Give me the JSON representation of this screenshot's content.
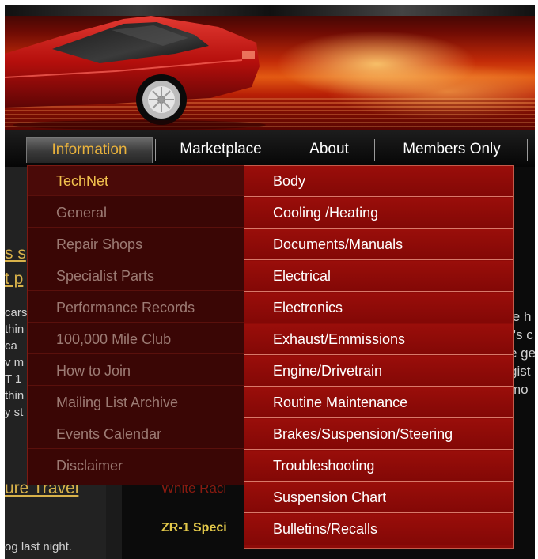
{
  "nav": {
    "items": [
      {
        "label": "Information"
      },
      {
        "label": "Marketplace"
      },
      {
        "label": "About"
      },
      {
        "label": "Members Only"
      }
    ]
  },
  "dropdown": {
    "items": [
      {
        "label": "TechNet"
      },
      {
        "label": "General"
      },
      {
        "label": "Repair Shops"
      },
      {
        "label": "Specialist Parts"
      },
      {
        "label": "Performance Records"
      },
      {
        "label": "100,000 Mile Club"
      },
      {
        "label": "How to Join"
      },
      {
        "label": "Mailing List Archive"
      },
      {
        "label": "Events Calendar"
      },
      {
        "label": "Disclaimer"
      }
    ]
  },
  "submenu": {
    "items": [
      {
        "label": "Body"
      },
      {
        "label": "Cooling /Heating"
      },
      {
        "label": "Documents/Manuals"
      },
      {
        "label": "Electrical"
      },
      {
        "label": "Electronics"
      },
      {
        "label": "Exhaust/Emmissions"
      },
      {
        "label": "Engine/Drivetrain"
      },
      {
        "label": "Routine Maintenance"
      },
      {
        "label": "Brakes/Suspension/Steering"
      },
      {
        "label": "Troubleshooting"
      },
      {
        "label": "Suspension Chart"
      },
      {
        "label": "Bulletins/Recalls"
      }
    ]
  },
  "background_fragments": {
    "left_link_1": "s s",
    "left_link_2": "t p",
    "left_lines": [
      "cars",
      "thin",
      "ca",
      "v m",
      "T 1",
      "thin",
      "y st"
    ],
    "left_link_3": "ure Travel",
    "left_bottom": "og last night.",
    "main_red": "White Raci",
    "main_gold": "ZR-1 Speci",
    "right_lines": [
      "le h",
      "t's c",
      "e ge",
      "gist",
      "mo"
    ]
  },
  "colors": {
    "nav_active": "#e9b23c",
    "submenu_bg": "#8e0b08",
    "dropdown_bg": "#3a0605",
    "dropdown_active_text": "#f2c24e"
  }
}
